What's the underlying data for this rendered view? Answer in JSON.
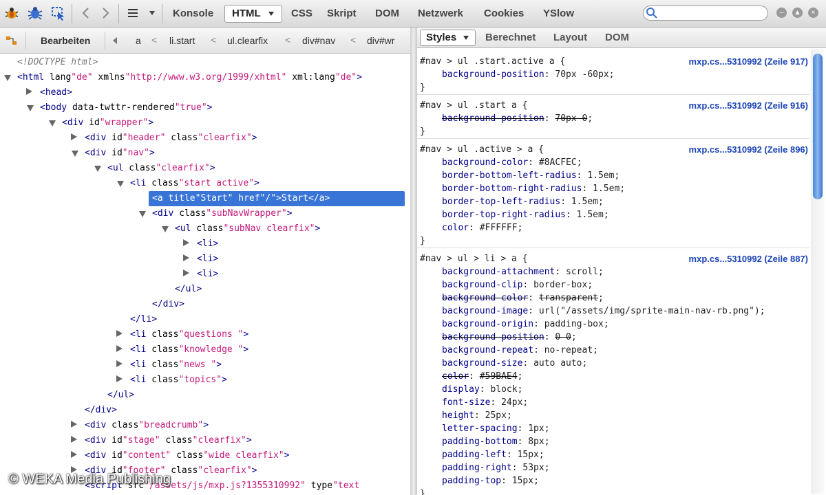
{
  "toolbar": {
    "tabs": [
      {
        "label": "Konsole"
      },
      {
        "label": "HTML"
      },
      {
        "label": "CSS"
      },
      {
        "label": "Skript"
      },
      {
        "label": "DOM"
      },
      {
        "label": "Netzwerk"
      },
      {
        "label": "Cookies"
      },
      {
        "label": "YSlow"
      }
    ],
    "active_tab": "HTML",
    "search": {
      "value": ""
    }
  },
  "breadcrumb": {
    "edit_label": "Bearbeiten",
    "items": [
      "a",
      "li.start",
      "ul.clearfix",
      "div#nav",
      "div#wr"
    ]
  },
  "tree": [
    {
      "t": "<!DOCTYPE html>"
    },
    {
      "t": "<html lang=\"de\" xmlns=\"http://www.w3.org/1999/xhtml\" xml:lang=\"de\">"
    },
    {
      "t": "<head>"
    },
    {
      "t": "<body data-twttr-rendered=\"true\">"
    },
    {
      "t": "<div id=\"wrapper\">"
    },
    {
      "t": "<div id=\"header\" class=\"clearfix\">"
    },
    {
      "t": "<div id=\"nav\">"
    },
    {
      "t": "<ul class=\"clearfix\">"
    },
    {
      "t": "<li class=\"start active\">"
    },
    {
      "t": "<a title=\"Start\" href=\"/\">Start</a>"
    },
    {
      "t": "<div class=\"subNavWrapper\">"
    },
    {
      "t": "<ul class=\"subNav clearfix\">"
    },
    {
      "t": "<li>"
    },
    {
      "t": "<li>"
    },
    {
      "t": "<li>"
    },
    {
      "t": "</ul>"
    },
    {
      "t": "</div>"
    },
    {
      "t": "</li>"
    },
    {
      "t": "<li class=\"questions \">"
    },
    {
      "t": "<li class=\"knowledge \">"
    },
    {
      "t": "<li class=\"news \">"
    },
    {
      "t": "<li class=\"topics\">"
    },
    {
      "t": "</ul>"
    },
    {
      "t": "</div>"
    },
    {
      "t": "<div class=\"breadcrumb\">"
    },
    {
      "t": "<div id=\"stage\" class=\"clearfix\">"
    },
    {
      "t": "<div id=\"content\" class=\"wide clearfix\">"
    },
    {
      "t": "<div id=\"footer\" class=\"clearfix\">"
    },
    {
      "t": "<script src=\"/assets/js/mxp.js?1355310992\" type=\"text"
    }
  ],
  "right": {
    "tabs": [
      {
        "label": "Styles"
      },
      {
        "label": "Berechnet"
      },
      {
        "label": "Layout"
      },
      {
        "label": "DOM"
      }
    ],
    "rules": [
      {
        "selector": "#nav > ul .start.active a {",
        "source": "mxp.cs...5310992 (Zeile 917)",
        "props": [
          {
            "name": "background-position",
            "value": "70px -60px",
            "overridden": false
          }
        ]
      },
      {
        "selector": "#nav > ul .start a {",
        "source": "mxp.cs...5310992 (Zeile 916)",
        "props": [
          {
            "name": "background-position",
            "value": "70px 0",
            "overridden": true
          }
        ]
      },
      {
        "selector": "#nav > ul .active > a {",
        "source": "mxp.cs...5310992 (Zeile 896)",
        "props": [
          {
            "name": "background-color",
            "value": "#8ACFEC",
            "overridden": false
          },
          {
            "name": "border-bottom-left-radius",
            "value": "1.5em",
            "overridden": false
          },
          {
            "name": "border-bottom-right-radius",
            "value": "1.5em",
            "overridden": false
          },
          {
            "name": "border-top-left-radius",
            "value": "1.5em",
            "overridden": false
          },
          {
            "name": "border-top-right-radius",
            "value": "1.5em",
            "overridden": false
          },
          {
            "name": "color",
            "value": "#FFFFFF",
            "overridden": false
          }
        ]
      },
      {
        "selector": "#nav > ul > li > a {",
        "source": "mxp.cs...5310992 (Zeile 887)",
        "props": [
          {
            "name": "background-attachment",
            "value": "scroll",
            "overridden": false
          },
          {
            "name": "background-clip",
            "value": "border-box",
            "overridden": false
          },
          {
            "name": "background-color",
            "value": "transparent",
            "overridden": true
          },
          {
            "name": "background-image",
            "value": "url(\"/assets/img/sprite-main-nav-rb.png\")",
            "overridden": false
          },
          {
            "name": "background-origin",
            "value": "padding-box",
            "overridden": false
          },
          {
            "name": "background-position",
            "value": "0 0",
            "overridden": true
          },
          {
            "name": "background-repeat",
            "value": "no-repeat",
            "overridden": false
          },
          {
            "name": "background-size",
            "value": "auto auto",
            "overridden": false
          },
          {
            "name": "color",
            "value": "#59BAE4",
            "overridden": true
          },
          {
            "name": "display",
            "value": "block",
            "overridden": false
          },
          {
            "name": "font-size",
            "value": "24px",
            "overridden": false
          },
          {
            "name": "height",
            "value": "25px",
            "overridden": false
          },
          {
            "name": "letter-spacing",
            "value": "1px",
            "overridden": false
          },
          {
            "name": "padding-bottom",
            "value": "8px",
            "overridden": false
          },
          {
            "name": "padding-left",
            "value": "15px",
            "overridden": false
          },
          {
            "name": "padding-right",
            "value": "53px",
            "overridden": false
          },
          {
            "name": "padding-top",
            "value": "15px",
            "overridden": false
          }
        ]
      }
    ]
  },
  "watermark": "© WEKA Media Publishing",
  "colors": {
    "selection": "#3875d7",
    "tag": "#000088",
    "attr_value": "#c4197b",
    "source_link": "#1a43b5"
  }
}
